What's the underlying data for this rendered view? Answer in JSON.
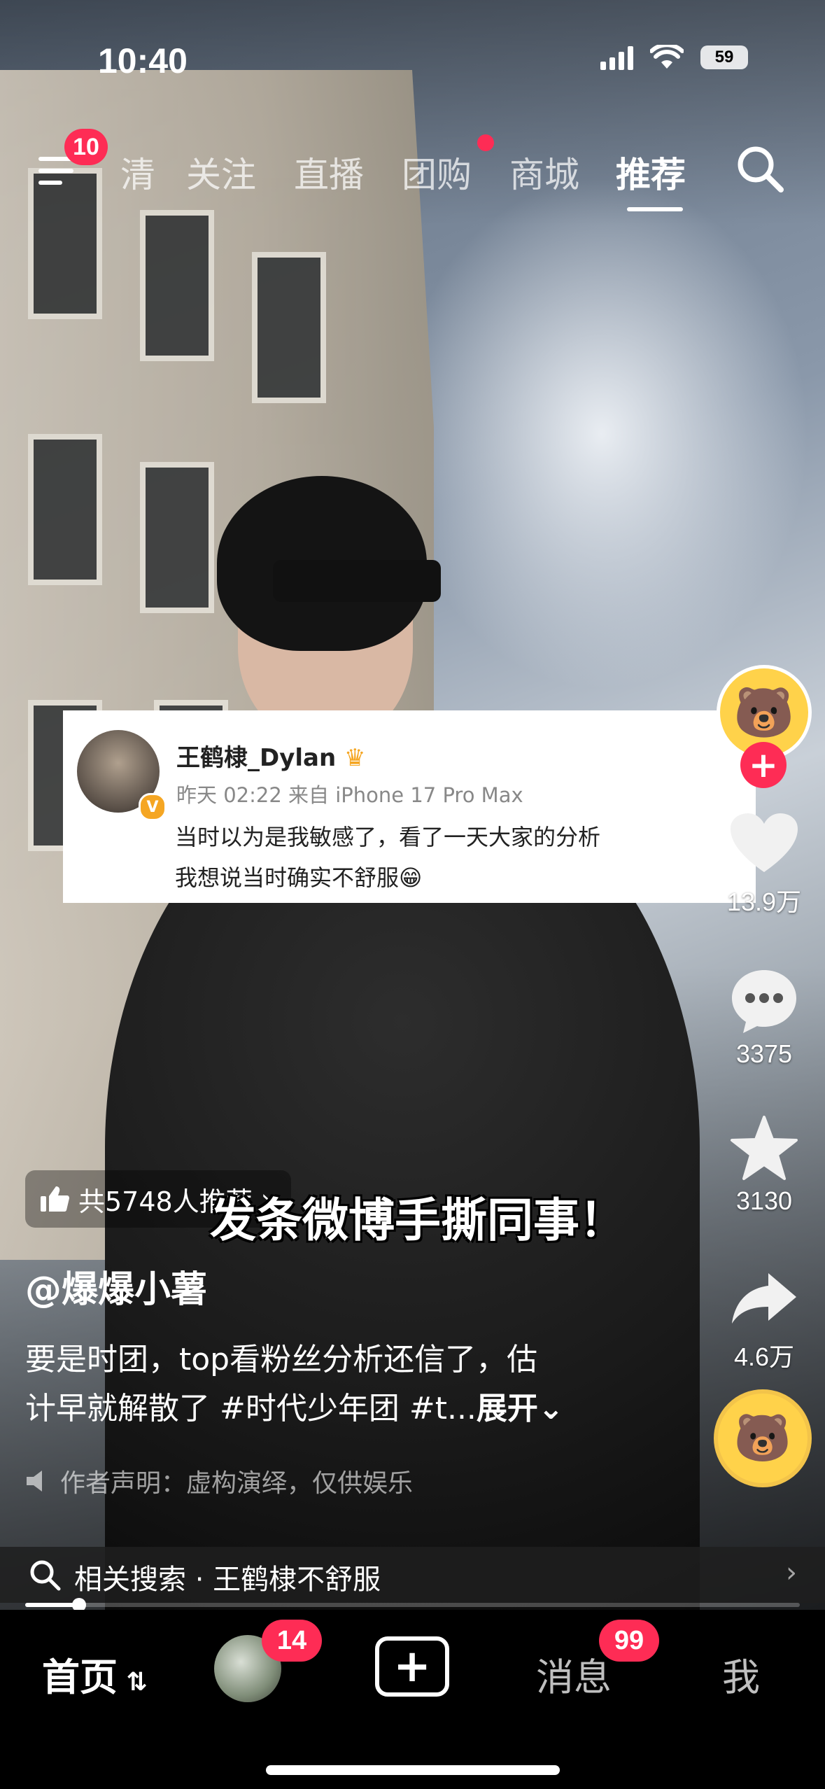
{
  "status_bar": {
    "time": "10:40",
    "battery": "59"
  },
  "top_nav": {
    "menu_badge": "10",
    "tabs": [
      {
        "label": "清",
        "active": false
      },
      {
        "label": "关注",
        "active": false
      },
      {
        "label": "直播",
        "active": false
      },
      {
        "label": "团购",
        "active": false,
        "dot": true
      },
      {
        "label": "商城",
        "active": false
      },
      {
        "label": "推荐",
        "active": true
      }
    ]
  },
  "weibo_card": {
    "name": "王鹤棣_Dylan",
    "verified_mark": "V",
    "meta": "昨天 02:22 来自 iPhone 17 Pro Max",
    "line1": "当时以为是我敏感了，看了一天大家的分析",
    "line2": "我想说当时确实不舒服😁"
  },
  "right_rail": {
    "likes": "13.9万",
    "comments": "3375",
    "favorites": "3130",
    "shares": "4.6万",
    "follow_label": "+"
  },
  "video": {
    "recommend_pill": "共5748人推荐",
    "caption_overlay": "发条微博手撕同事！",
    "author": "@爆爆小薯",
    "description_line1": "要是时团，top看粉丝分析还信了，估",
    "description_line2": "计早就解散了 #时代少年团 #t...",
    "expand_label": "展开",
    "disclaimer": "作者声明：虚构演绎，仅供娱乐"
  },
  "related_search": {
    "label": "相关搜索 · 王鹤棣不舒服"
  },
  "progress": {
    "fraction": 0.07
  },
  "tab_bar": {
    "home": "首页",
    "friends_badge": "14",
    "create": "+",
    "messages": "消息",
    "messages_badge": "99",
    "me": "我"
  }
}
